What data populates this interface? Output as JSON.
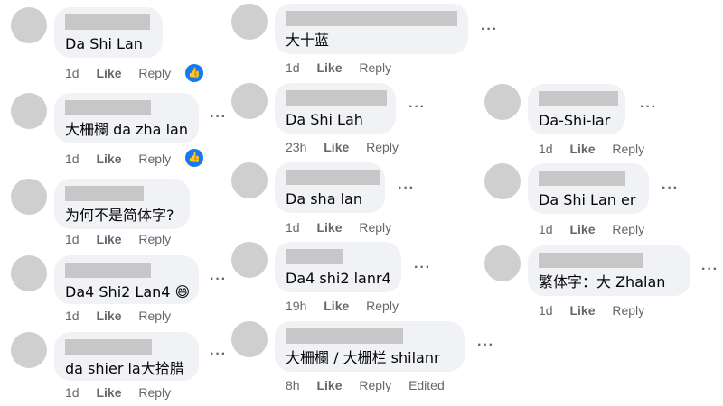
{
  "icons": {
    "more": "more-icon",
    "like_reaction": "thumbs-up-icon"
  },
  "colors": {
    "accent": "#1877f2",
    "bubble": "#f0f2f5",
    "meta": "#65676b"
  },
  "actions": {
    "like": "Like",
    "reply": "Reply",
    "edited": "Edited"
  },
  "comments": [
    {
      "text": "Da Shi Lan",
      "time": "1d",
      "reaction": true
    },
    {
      "text": "大柵欄 da zha lan",
      "time": "1d",
      "reaction": true
    },
    {
      "text": "为何不是简体字?",
      "time": "1d"
    },
    {
      "text": "Da4 Shi2 Lan4 😄",
      "time": "1d"
    },
    {
      "text": "da shier la大拾腊",
      "time": "1d"
    },
    {
      "text": "大十蓝",
      "time": "1d"
    },
    {
      "text": "Da Shi Lah",
      "time": "23h"
    },
    {
      "text": "Da sha lan",
      "time": "1d"
    },
    {
      "text": "Da4 shi2 lanr4",
      "time": "19h"
    },
    {
      "text": "大柵欄 / 大栅栏 shilanr",
      "time": "8h",
      "edited": true
    },
    {
      "text": "Da-Shi-lar",
      "time": "1d"
    },
    {
      "text": "Da Shi Lan er",
      "time": "1d"
    },
    {
      "text": "繁体字：大 Zhalan",
      "time": "1d"
    }
  ]
}
